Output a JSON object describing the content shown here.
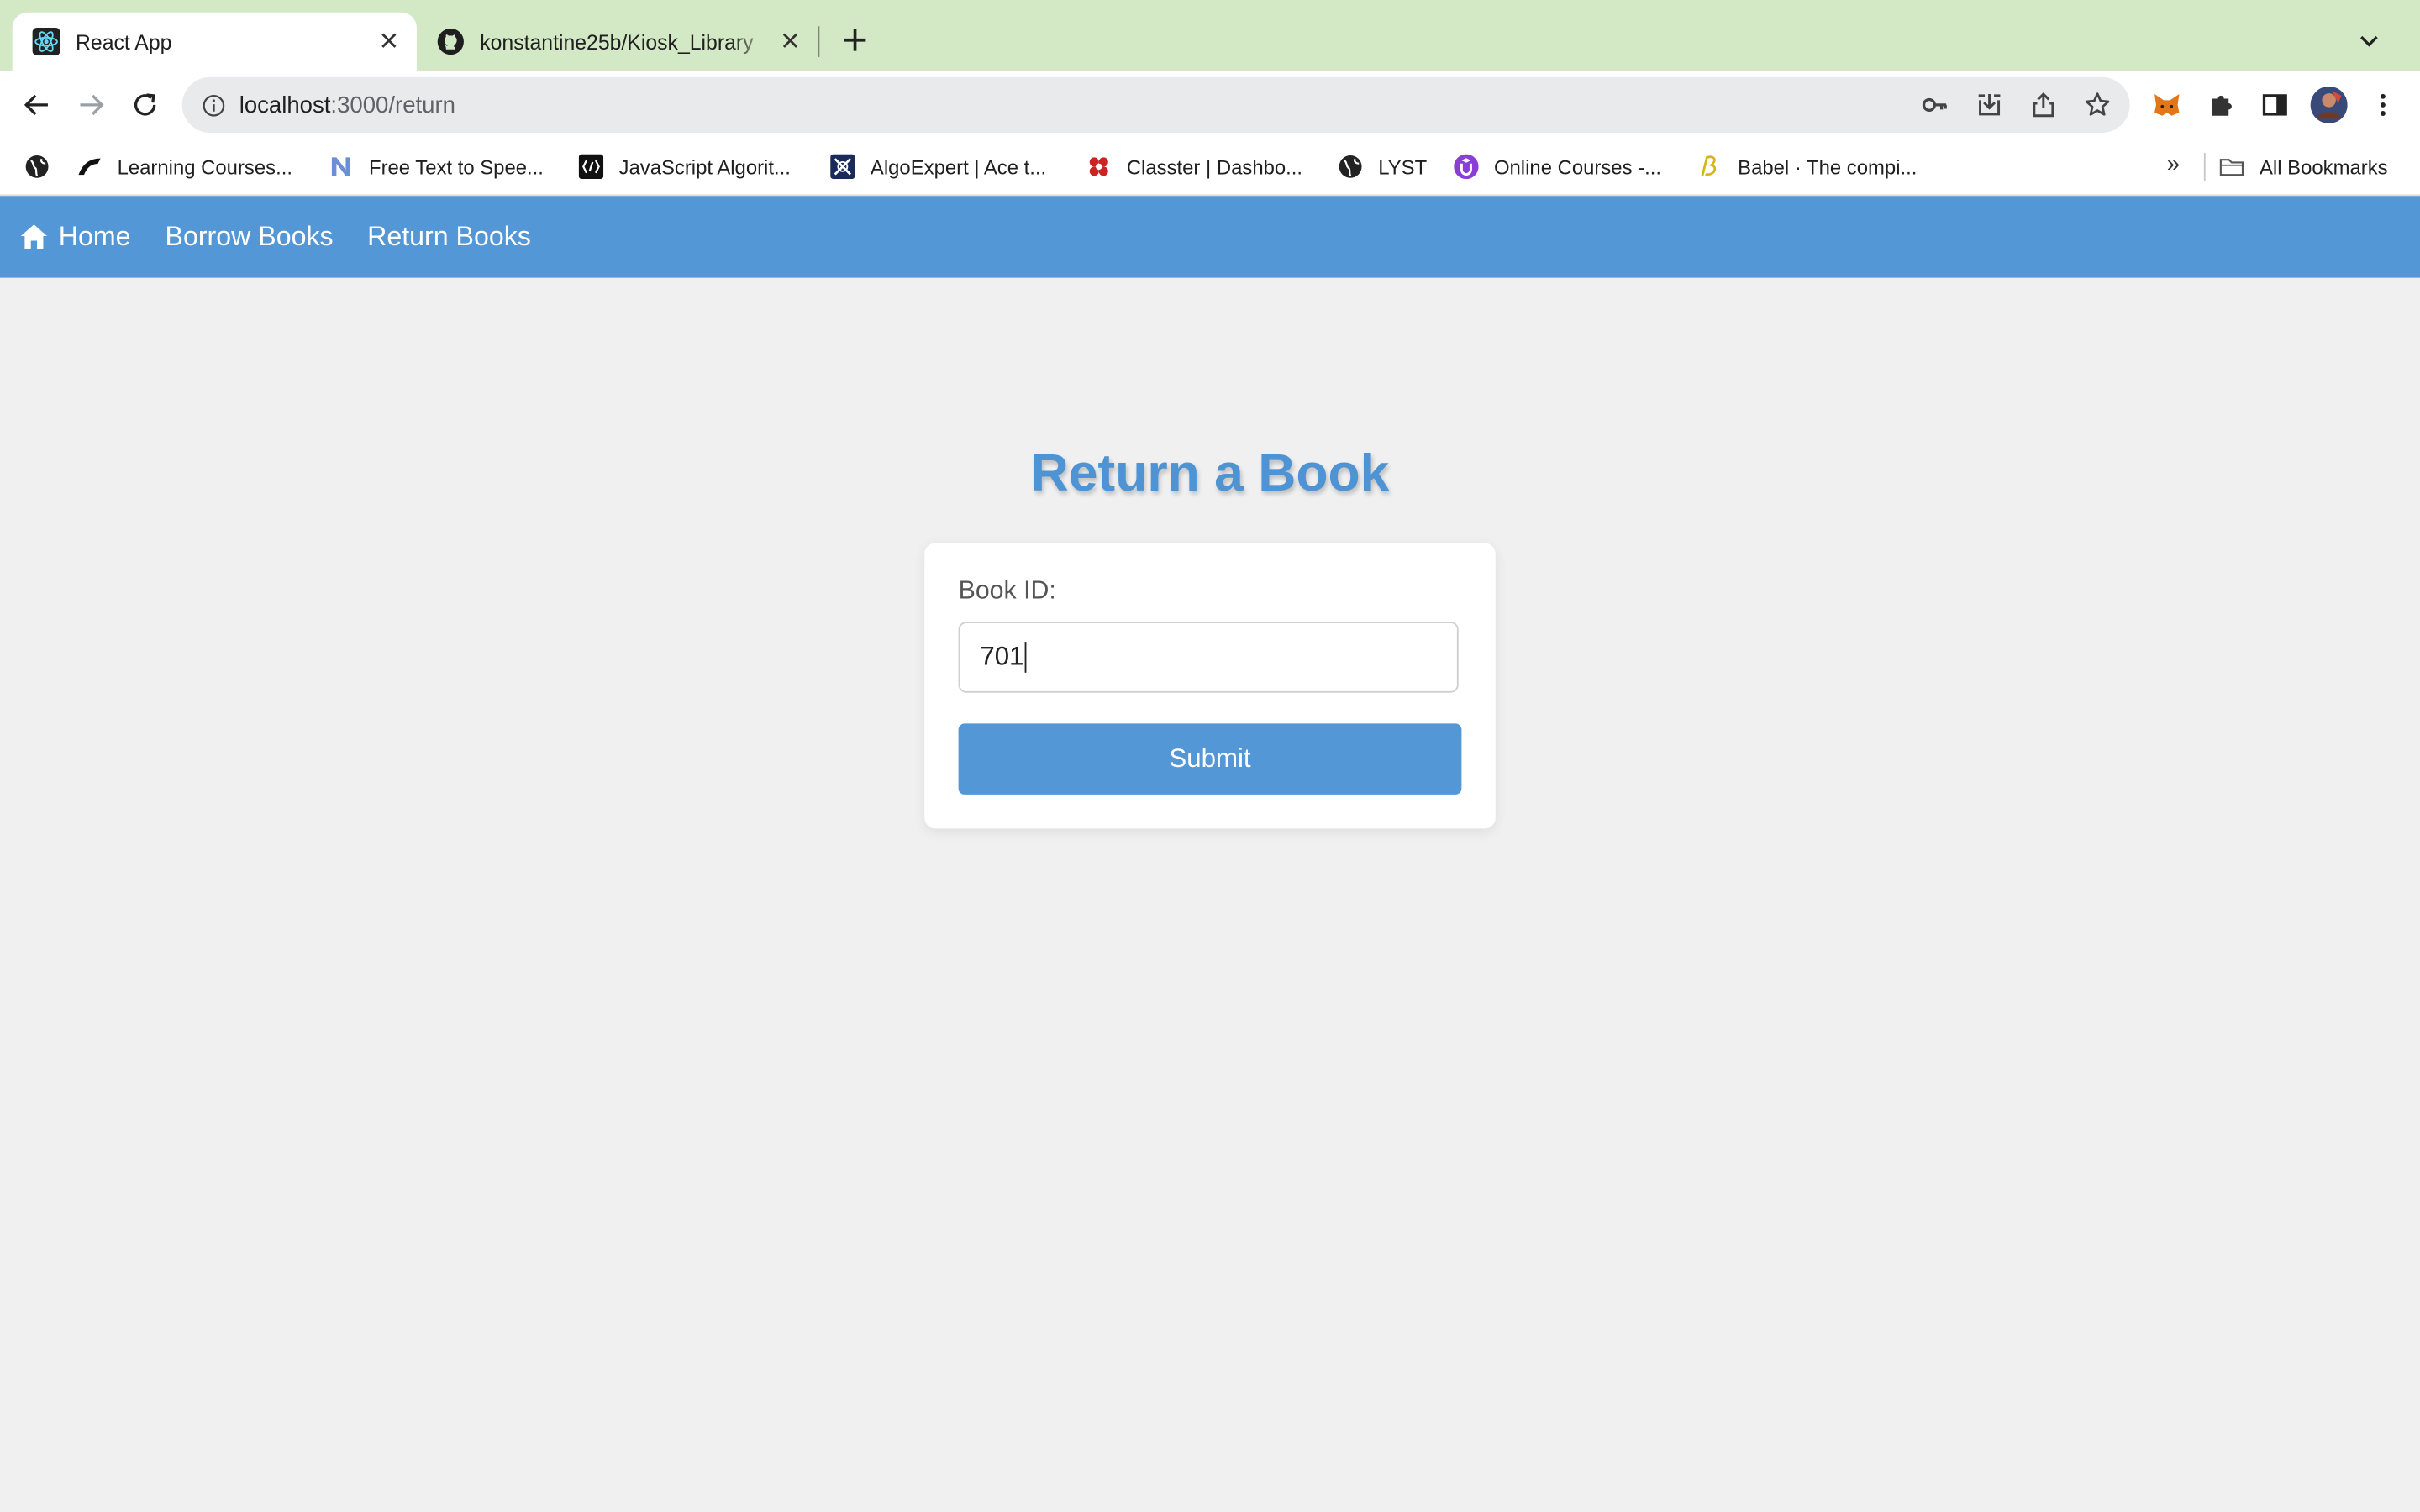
{
  "browser": {
    "tabs": [
      {
        "title": "React App",
        "favicon": "react-icon",
        "active": true
      },
      {
        "title": "konstantine25b/Kiosk_Library",
        "favicon": "github-icon",
        "active": false
      }
    ],
    "url": {
      "host": "localhost",
      "path": ":3000/return"
    },
    "bookmarks": [
      {
        "label": "",
        "icon": "globe-icon"
      },
      {
        "label": "Learning Courses...",
        "icon": "academy-icon"
      },
      {
        "label": "Free Text to Spee...",
        "icon": "n-icon"
      },
      {
        "label": "JavaScript Algorit...",
        "icon": "code-icon"
      },
      {
        "label": "AlgoExpert | Ace t...",
        "icon": "algoexpert-icon"
      },
      {
        "label": "Classter | Dashbo...",
        "icon": "classter-icon"
      },
      {
        "label": "LYST",
        "icon": "globe-icon"
      },
      {
        "label": "Online Courses -...",
        "icon": "udemy-icon"
      },
      {
        "label": "Babel · The compi...",
        "icon": "babel-icon"
      }
    ],
    "bookmarks_overflow": "»",
    "all_bookmarks": "All Bookmarks"
  },
  "app": {
    "nav": [
      {
        "label": "Home",
        "icon": "home-icon"
      },
      {
        "label": "Borrow Books"
      },
      {
        "label": "Return Books"
      }
    ],
    "heading": "Return a Book",
    "form": {
      "label": "Book ID:",
      "value": "701",
      "submit": "Submit"
    }
  },
  "colors": {
    "tab_strip": "#d3e8c5",
    "nav_bar": "#5397d6",
    "heading": "#4e93d3",
    "background": "#f0f0f1"
  }
}
